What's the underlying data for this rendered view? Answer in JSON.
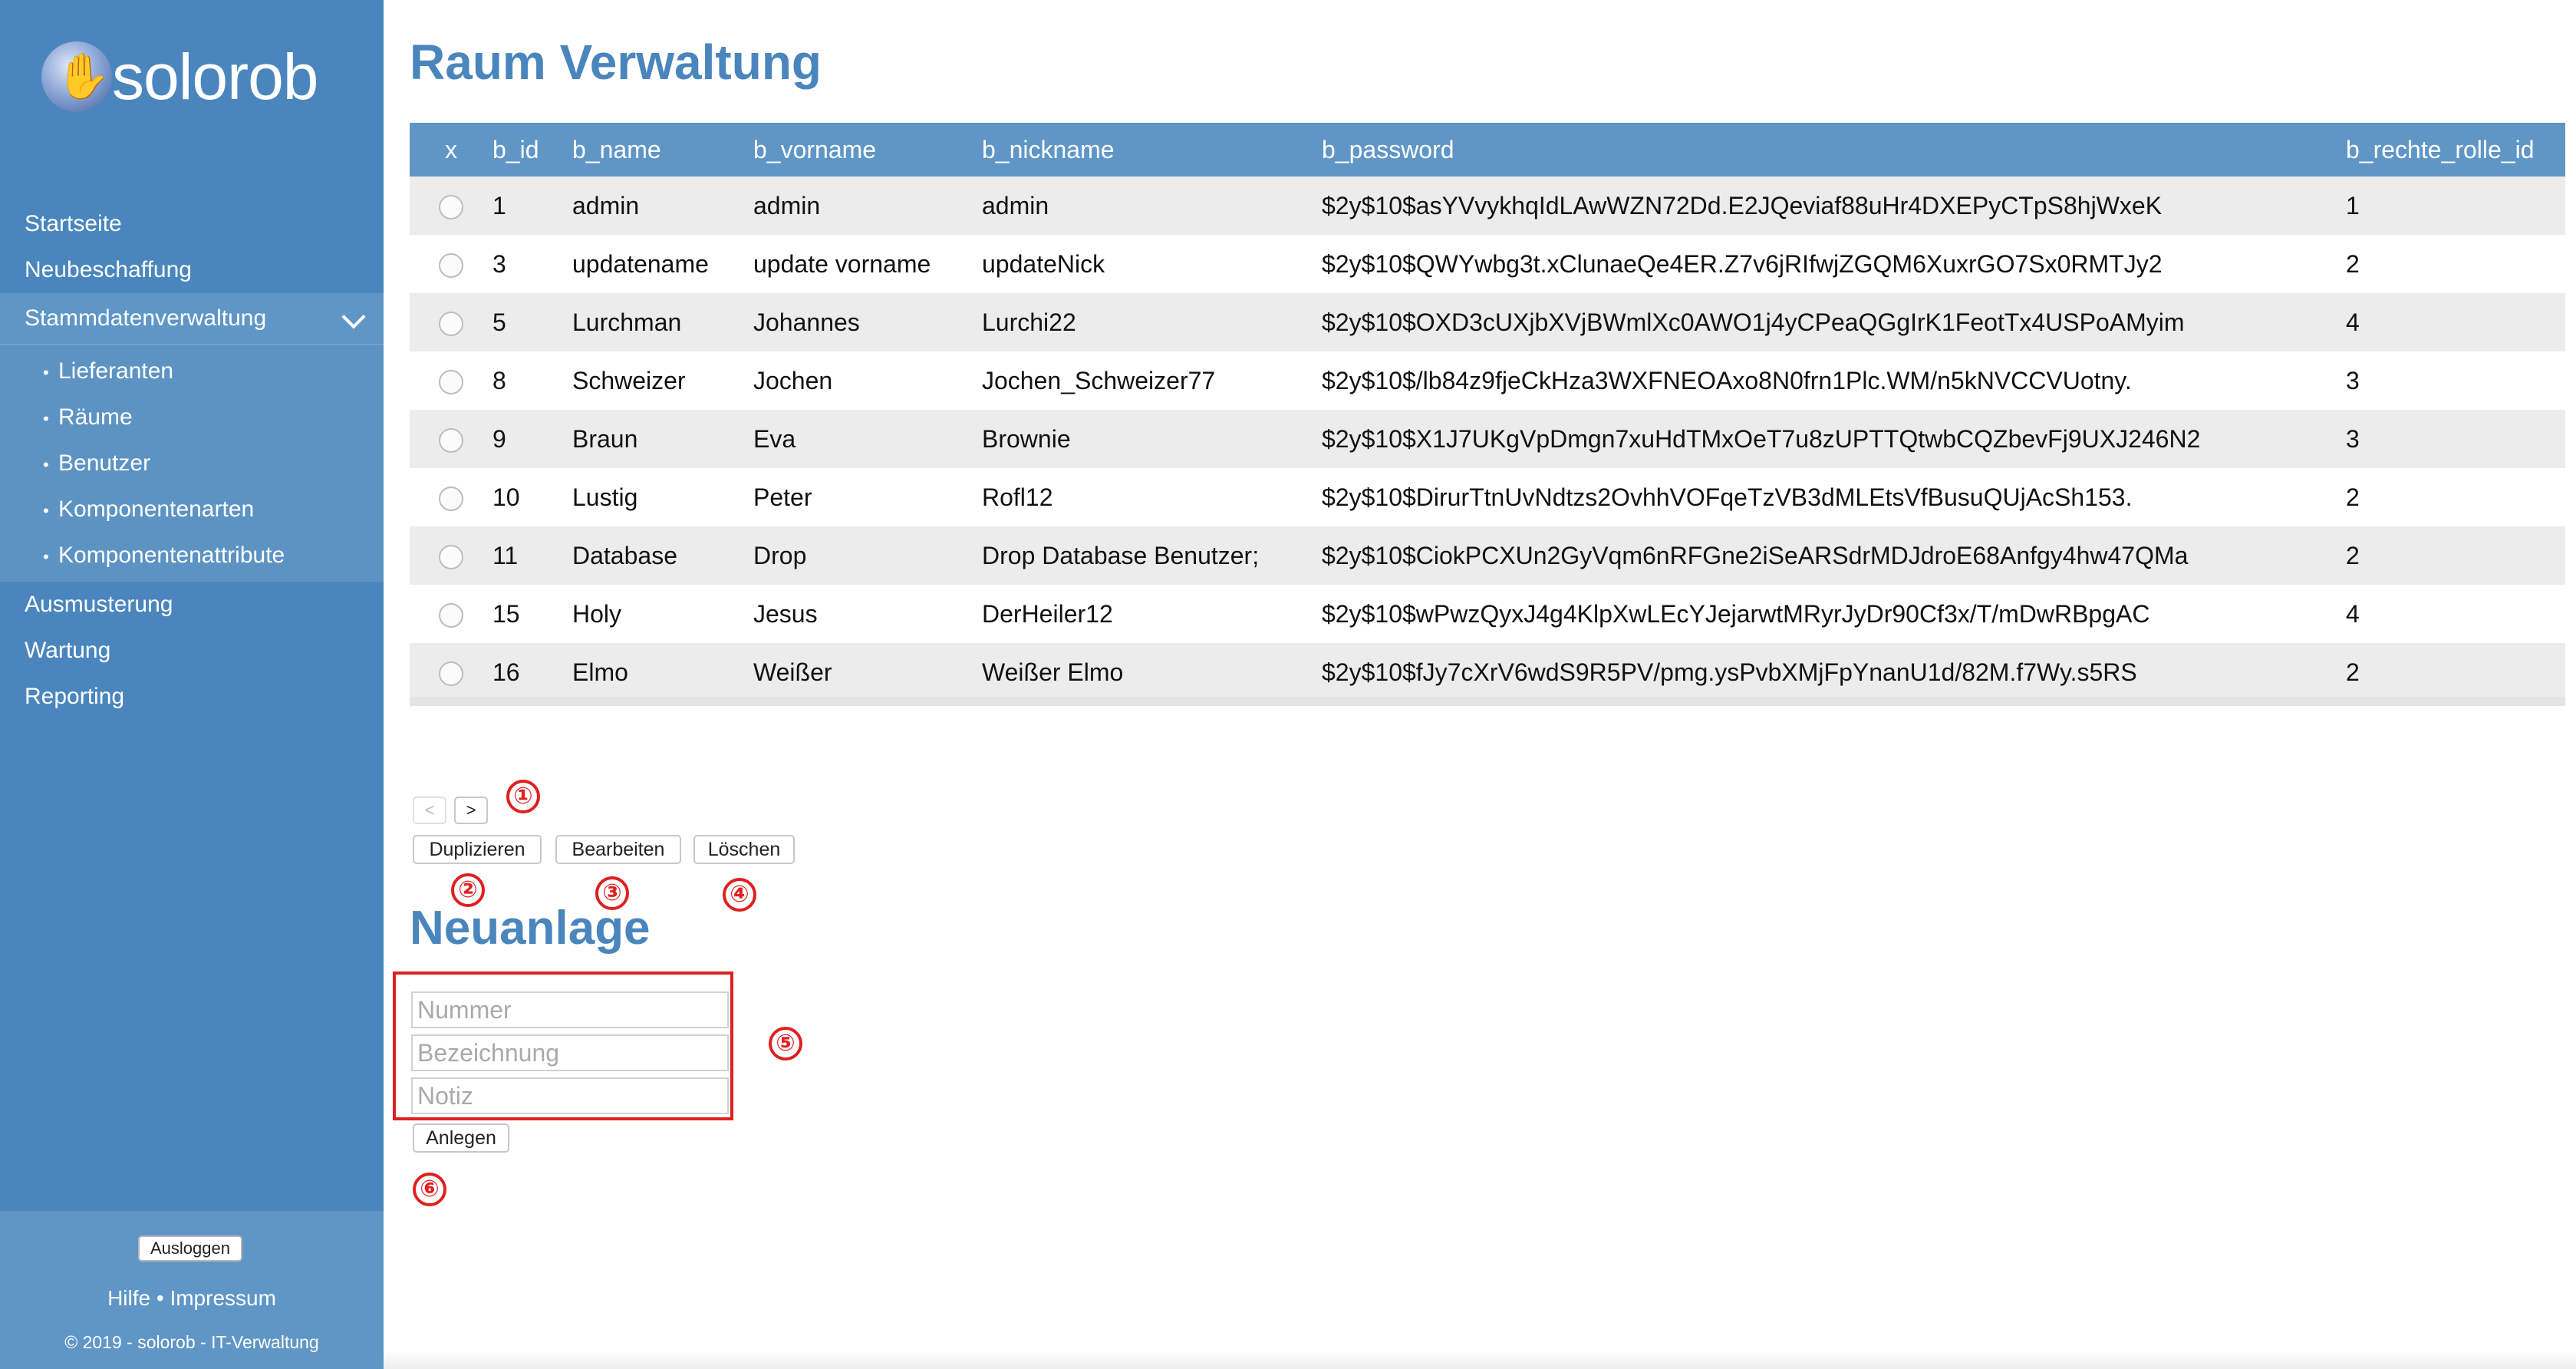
{
  "app": {
    "logo_text": "solorob"
  },
  "sidebar": {
    "items": [
      {
        "label": "Startseite"
      },
      {
        "label": "Neubeschaffung"
      },
      {
        "label": "Stammdatenverwaltung"
      },
      {
        "label": "Ausmusterung"
      },
      {
        "label": "Wartung"
      },
      {
        "label": "Reporting"
      }
    ],
    "subitems": [
      {
        "label": "Lieferanten"
      },
      {
        "label": "Räume"
      },
      {
        "label": "Benutzer"
      },
      {
        "label": "Komponentenarten"
      },
      {
        "label": "Komponentenattribute"
      }
    ],
    "bullet": "•",
    "logout_label": "Ausloggen",
    "help_label": "Hilfe",
    "separator": " • ",
    "imprint_label": "Impressum",
    "copyright": "© 2019 - solorob - IT-Verwaltung"
  },
  "main": {
    "title": "Raum Verwaltung",
    "table": {
      "columns": [
        "x",
        "b_id",
        "b_name",
        "b_vorname",
        "b_nickname",
        "b_password",
        "b_rechte_rolle_id"
      ],
      "rows": [
        [
          "1",
          "admin",
          "admin",
          "admin",
          "$2y$10$asYVvykhqIdLAwWZN72Dd.E2JQeviaf88uHr4DXEPyCTpS8hjWxeK",
          "1"
        ],
        [
          "3",
          "updatename",
          "update vorname",
          "updateNick",
          "$2y$10$QWYwbg3t.xClunaeQe4ER.Z7v6jRIfwjZGQM6XuxrGO7Sx0RMTJy2",
          "2"
        ],
        [
          "5",
          "Lurchman",
          "Johannes",
          "Lurchi22",
          "$2y$10$OXD3cUXjbXVjBWmlXc0AWO1j4yCPeaQGgIrK1FeotTx4USPoAMyim",
          "4"
        ],
        [
          "8",
          "Schweizer",
          "Jochen",
          "Jochen_Schweizer77",
          "$2y$10$/lb84z9fjeCkHza3WXFNEOAxo8N0frn1Plc.WM/n5kNVCCVUotny.",
          "3"
        ],
        [
          "9",
          "Braun",
          "Eva",
          "Brownie",
          "$2y$10$X1J7UKgVpDmgn7xuHdTMxOeT7u8zUPTTQtwbCQZbevFj9UXJ246N2",
          "3"
        ],
        [
          "10",
          "Lustig",
          "Peter",
          "Rofl12",
          "$2y$10$DirurTtnUvNdtzs2OvhhVOFqeTzVB3dMLEtsVfBusuQUjAcSh153.",
          "2"
        ],
        [
          "11",
          "Database",
          "Drop",
          "Drop Database Benutzer;",
          "$2y$10$CiokPCXUn2GyVqm6nRFGne2iSeARSdrMDJdroE68Anfgy4hw47QMa",
          "2"
        ],
        [
          "15",
          "Holy",
          "Jesus",
          "DerHeiler12",
          "$2y$10$wPwzQyxJ4g4KlpXwLEcYJejarwtMRyrJyDr90Cf3x/T/mDwRBpgAC",
          "4"
        ],
        [
          "16",
          "Elmo",
          "Weißer",
          "Weißer Elmo",
          "$2y$10$fJy7cXrV6wdS9R5PV/pmg.ysPvbXMjFpYnanU1d/82M.f7Wy.s5RS",
          "2"
        ]
      ]
    },
    "pager": {
      "prev_label": "<",
      "next_label": ">"
    },
    "actions": {
      "duplicate_label": "Duplizieren",
      "edit_label": "Bearbeiten",
      "delete_label": "Löschen"
    },
    "new_entry": {
      "title": "Neuanlage",
      "fields": [
        {
          "placeholder": "Nummer",
          "value": ""
        },
        {
          "placeholder": "Bezeichnung",
          "value": ""
        },
        {
          "placeholder": "Notiz",
          "value": ""
        }
      ],
      "create_label": "Anlegen"
    },
    "markers": [
      "①",
      "②",
      "③",
      "④",
      "⑤",
      "⑥"
    ]
  },
  "colors": {
    "sidebar": "#4a86bd",
    "sidebar_active": "#5f96c6",
    "title": "#4a86bd",
    "table_header": "#5f96c6",
    "row_stripe": "#ececec",
    "annotation": "#e02020"
  }
}
